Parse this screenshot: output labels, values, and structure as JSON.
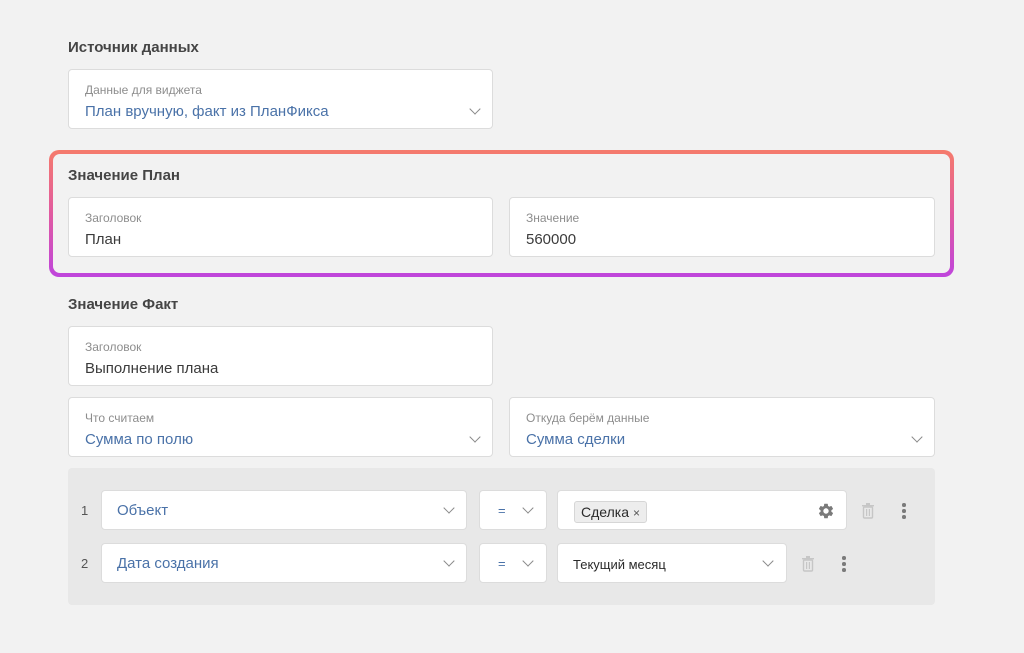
{
  "source": {
    "title": "Источник данных",
    "widget_data": {
      "label": "Данные для виджета",
      "value": "План вручную, факт из ПланФикса"
    }
  },
  "plan": {
    "title": "Значение План",
    "heading": {
      "label": "Заголовок",
      "value": "План"
    },
    "value": {
      "label": "Значение",
      "value": "560000"
    }
  },
  "fact": {
    "title": "Значение Факт",
    "heading": {
      "label": "Заголовок",
      "value": "Выполнение плана"
    },
    "what_count": {
      "label": "Что считаем",
      "value": "Сумма по полю"
    },
    "data_from": {
      "label": "Откуда берём данные",
      "value": "Сумма сделки"
    }
  },
  "filters": [
    {
      "num": "1",
      "field": "Объект",
      "op": "=",
      "value_chip": "Сделка",
      "chip_remove": "×"
    },
    {
      "num": "2",
      "field": "Дата создания",
      "op": "=",
      "value": "Текущий месяц"
    }
  ],
  "colors": {
    "accent_link": "#4a72a8",
    "highlight_top": "#f57b6c",
    "highlight_bottom": "#bf45dc"
  },
  "icons": [
    "chevron-down-icon",
    "gear-icon",
    "trash-icon",
    "more-vertical-icon",
    "close-icon"
  ]
}
